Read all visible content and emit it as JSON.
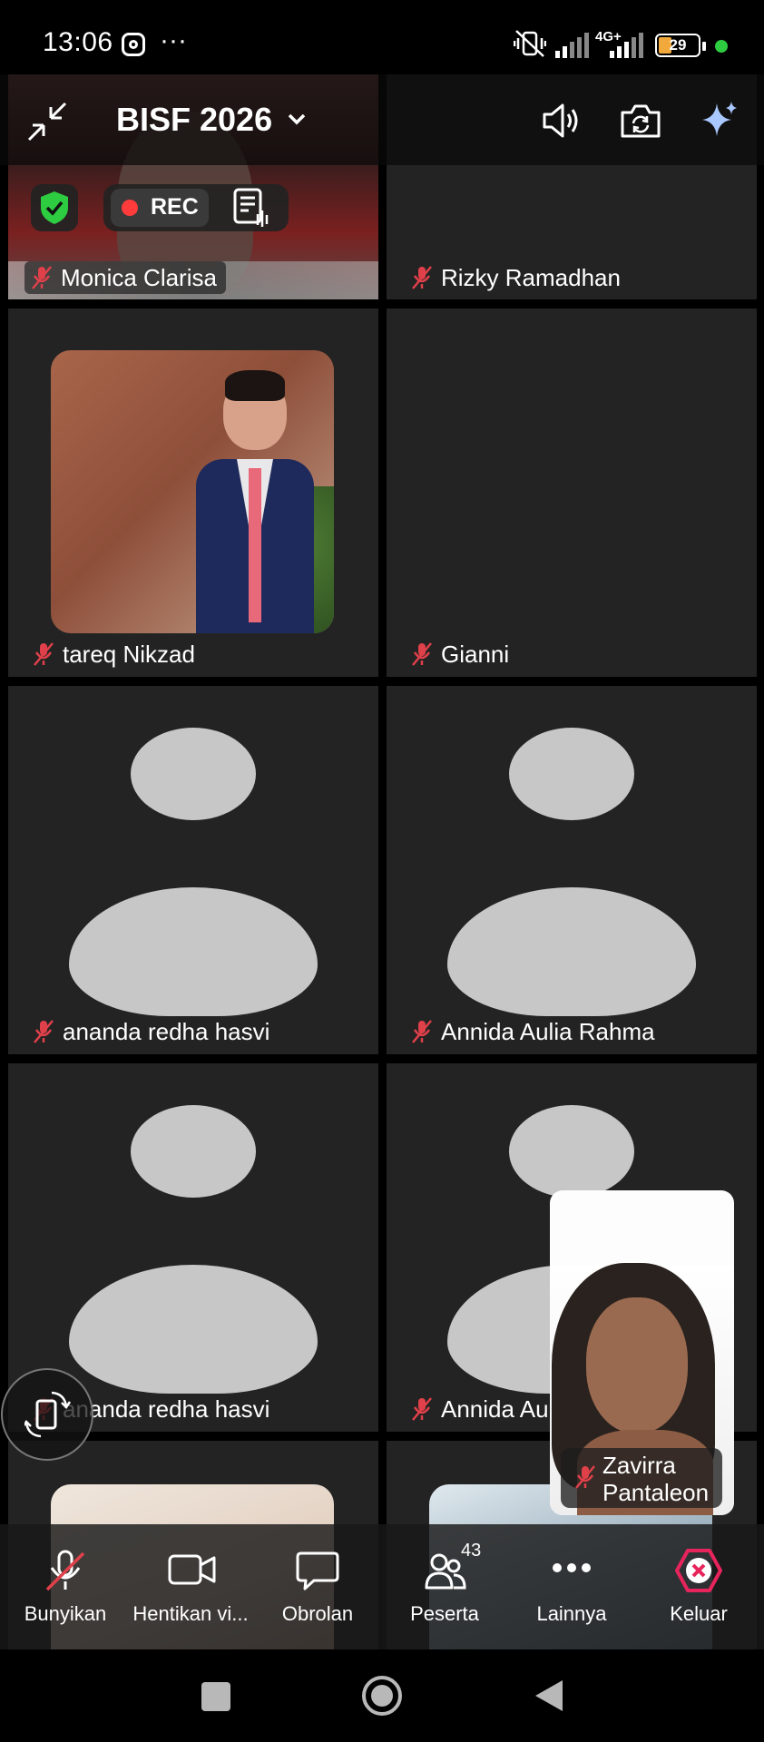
{
  "status_bar": {
    "time": "13:06",
    "battery": "29",
    "network": "4G+"
  },
  "meeting": {
    "title": "BISF 2026",
    "rec_label": "REC"
  },
  "participants": {
    "p1": "Monica Clarisa",
    "p2": "Rizky Ramadhan",
    "p3": "tareq Nikzad",
    "p4": "Gianni",
    "p5": "ananda redha hasvi",
    "p6": "Annida Aulia Rahma",
    "p7": "ananda redha hasvi",
    "p8": "Annida Aul",
    "self_first": "Zavirra",
    "self_last": "Pantaleon"
  },
  "toolbar": {
    "unmute": "Bunyikan",
    "stop_video": "Hentikan vi...",
    "chat": "Obrolan",
    "participants": "Peserta",
    "participants_count": "43",
    "more": "Lainnya",
    "leave": "Keluar"
  },
  "colors": {
    "leave_accent": "#e8245c",
    "mute_red": "#e0404a",
    "shield_green": "#2ecc40",
    "rec_red": "#ff3b3b"
  }
}
